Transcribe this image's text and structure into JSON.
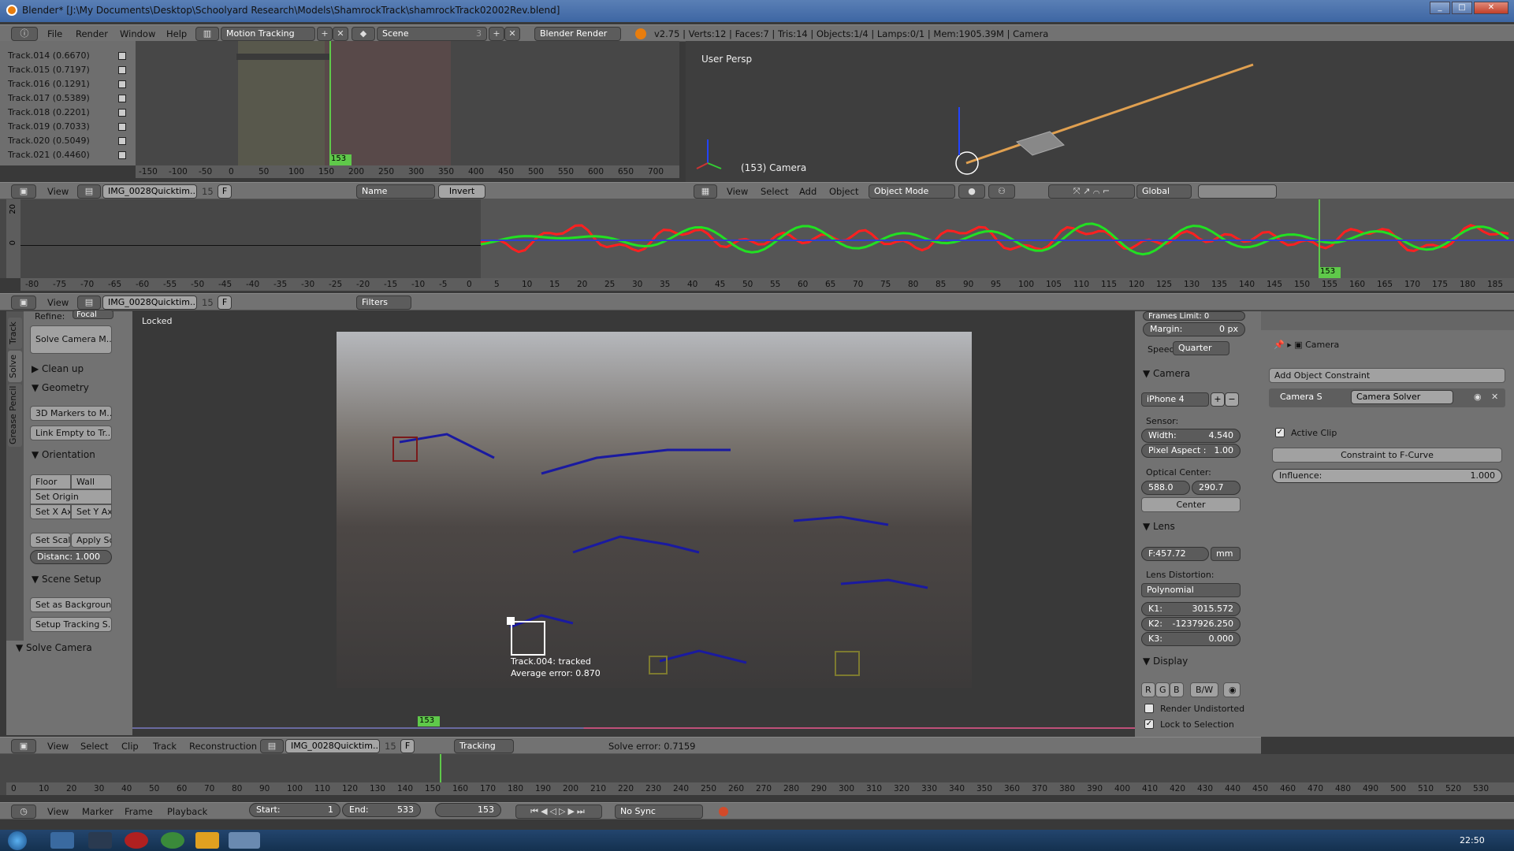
{
  "window": {
    "title": "Blender* [J:\\My Documents\\Desktop\\Schoolyard Research\\Models\\ShamrockTrack\\shamrockTrack02002Rev.blend]",
    "controls": [
      "minimize",
      "maximize",
      "close"
    ]
  },
  "info_header": {
    "menus": [
      "File",
      "Render",
      "Window",
      "Help"
    ],
    "screen_layout": "Motion Tracking",
    "scene": "Scene",
    "scene_users": "3",
    "render_engine": "Blender Render",
    "stats": "v2.75 | Verts:12 | Faces:7 | Tris:14 | Objects:1/4 | Lamps:0/1 | Mem:1905.39M | Camera"
  },
  "dopesheet": {
    "tracks": [
      {
        "name": "Track.014 (0.6670)"
      },
      {
        "name": "Track.015 (0.7197)"
      },
      {
        "name": "Track.016 (0.1291)"
      },
      {
        "name": "Track.017 (0.5389)"
      },
      {
        "name": "Track.018 (0.2201)"
      },
      {
        "name": "Track.019 (0.7033)"
      },
      {
        "name": "Track.020 (0.5049)"
      },
      {
        "name": "Track.021 (0.4460)"
      }
    ],
    "ruler_ticks": [
      "-150",
      "-100",
      "-50",
      "0",
      "50",
      "100",
      "150",
      "200",
      "250",
      "300",
      "350",
      "400",
      "450",
      "500",
      "550",
      "600",
      "650",
      "700"
    ],
    "current_frame": "153",
    "header": {
      "view": "View",
      "clip": "IMG_0028Quicktim...",
      "clip_users": "15",
      "f_label": "F",
      "sort": "Name",
      "invert": "Invert"
    }
  },
  "viewport3d": {
    "label": "User Persp",
    "object_label": "(153) Camera",
    "header": {
      "menus": [
        "View",
        "Select",
        "Add",
        "Object"
      ],
      "mode": "Object Mode",
      "orientation": "Global"
    }
  },
  "graph": {
    "y_ticks": [
      "20",
      "0"
    ],
    "ruler_ticks": [
      "-80",
      "-75",
      "-70",
      "-65",
      "-60",
      "-55",
      "-50",
      "-45",
      "-40",
      "-35",
      "-30",
      "-25",
      "-20",
      "-15",
      "-10",
      "-5",
      "0",
      "5",
      "10",
      "15",
      "20",
      "25",
      "30",
      "35",
      "40",
      "45",
      "50",
      "55",
      "60",
      "65",
      "70",
      "75",
      "80",
      "85",
      "90",
      "95",
      "100",
      "105",
      "110",
      "115",
      "120",
      "125",
      "130",
      "135",
      "140",
      "145",
      "150",
      "155",
      "160",
      "165",
      "170",
      "175",
      "180",
      "185"
    ],
    "current_frame": "153",
    "header": {
      "view": "View",
      "clip": "IMG_0028Quicktim...",
      "clip_users": "15",
      "f_label": "F",
      "filters": "Filters"
    }
  },
  "clip_tools": {
    "tabs": [
      "Track",
      "Solve",
      "Grease Pencil"
    ],
    "active_tab": "Solve",
    "refine_label": "Refine:",
    "refine_value": "Focal",
    "solve_button": "Solve Camera M...",
    "sections": {
      "cleanup": "Clean up",
      "geometry": "Geometry",
      "orientation": "Orientation",
      "scene_setup": "Scene Setup",
      "solve_camera": "Solve Camera"
    },
    "geometry_buttons": [
      "3D Markers to M...",
      "Link Empty to Tr..."
    ],
    "orientation_buttons": {
      "floor": "Floor",
      "wall": "Wall",
      "set_origin": "Set Origin",
      "set_x": "Set X Ax",
      "set_y": "Set Y Axi",
      "set_scale": "Set Scal",
      "apply_scale": "Apply Sc",
      "distance": "Distanc: 1.000"
    },
    "scene_setup_buttons": [
      "Set as Background",
      "Setup Tracking S..."
    ]
  },
  "clip_editor": {
    "locked_label": "Locked",
    "marker_label": "Track.004: tracked",
    "marker_error": "Average error: 0.870",
    "current_frame": "153",
    "header": {
      "menus": [
        "View",
        "Select",
        "Clip",
        "Track",
        "Reconstruction"
      ],
      "clip": "IMG_0028Quicktim...",
      "clip_users": "15",
      "f_label": "F",
      "mode": "Tracking",
      "solve_error": "Solve error: 0.7159"
    }
  },
  "clip_properties": {
    "frames_limit": "Frames Limit:  0",
    "margin_label": "Margin:",
    "margin_value": "0 px",
    "speed_label": "Speed:",
    "speed_value": "Quarter",
    "camera_section": "Camera",
    "camera_preset": "iPhone 4",
    "sensor_label": "Sensor:",
    "width_label": "Width:",
    "width_value": "4.540",
    "pixel_aspect_label": "Pixel Aspect :",
    "pixel_aspect_value": "1.00",
    "optical_center_label": "Optical Center:",
    "optical_x": "588.0",
    "optical_y": "290.7",
    "center_button": "Center",
    "lens_section": "Lens",
    "focal": "F:457.72",
    "focal_unit": "mm",
    "distortion_label": "Lens Distortion:",
    "distortion_model": "Polynomial",
    "k1_label": "K1:",
    "k1": "3015.572",
    "k2_label": "K2:",
    "k2": "-1237926.250",
    "k3_label": "K3:",
    "k3": "0.000",
    "display_section": "Display",
    "channels": [
      "R",
      "G",
      "B"
    ],
    "bw": "B/W",
    "render_undistorted": "Render Undistorted",
    "render_undistorted_checked": false,
    "lock_to_selection": "Lock to Selection",
    "lock_to_selection_checked": true
  },
  "object_properties": {
    "breadcrumb": "Camera",
    "add_constraint": "Add Object Constraint",
    "constraint_name": "Camera S",
    "constraint_type": "Camera Solver",
    "active_clip": "Active Clip",
    "active_clip_checked": true,
    "to_fcurve": "Constraint to F-Curve",
    "influence_label": "Influence:",
    "influence_value": "1.000"
  },
  "timeline": {
    "ruler_ticks": [
      "0",
      "10",
      "20",
      "30",
      "40",
      "50",
      "60",
      "70",
      "80",
      "90",
      "100",
      "110",
      "120",
      "130",
      "140",
      "150",
      "160",
      "170",
      "180",
      "190",
      "200",
      "210",
      "220",
      "230",
      "240",
      "250",
      "260",
      "270",
      "280",
      "290",
      "300",
      "310",
      "320",
      "330",
      "340",
      "350",
      "360",
      "370",
      "380",
      "390",
      "400",
      "410",
      "420",
      "430",
      "440",
      "450",
      "460",
      "470",
      "480",
      "490",
      "500",
      "510",
      "520",
      "530"
    ],
    "menus": [
      "View",
      "Marker",
      "Frame",
      "Playback"
    ],
    "start_label": "Start:",
    "start": "1",
    "end_label": "End:",
    "end": "533",
    "current": "153",
    "sync": "No Sync"
  },
  "taskbar": {
    "clock": "22:50"
  }
}
